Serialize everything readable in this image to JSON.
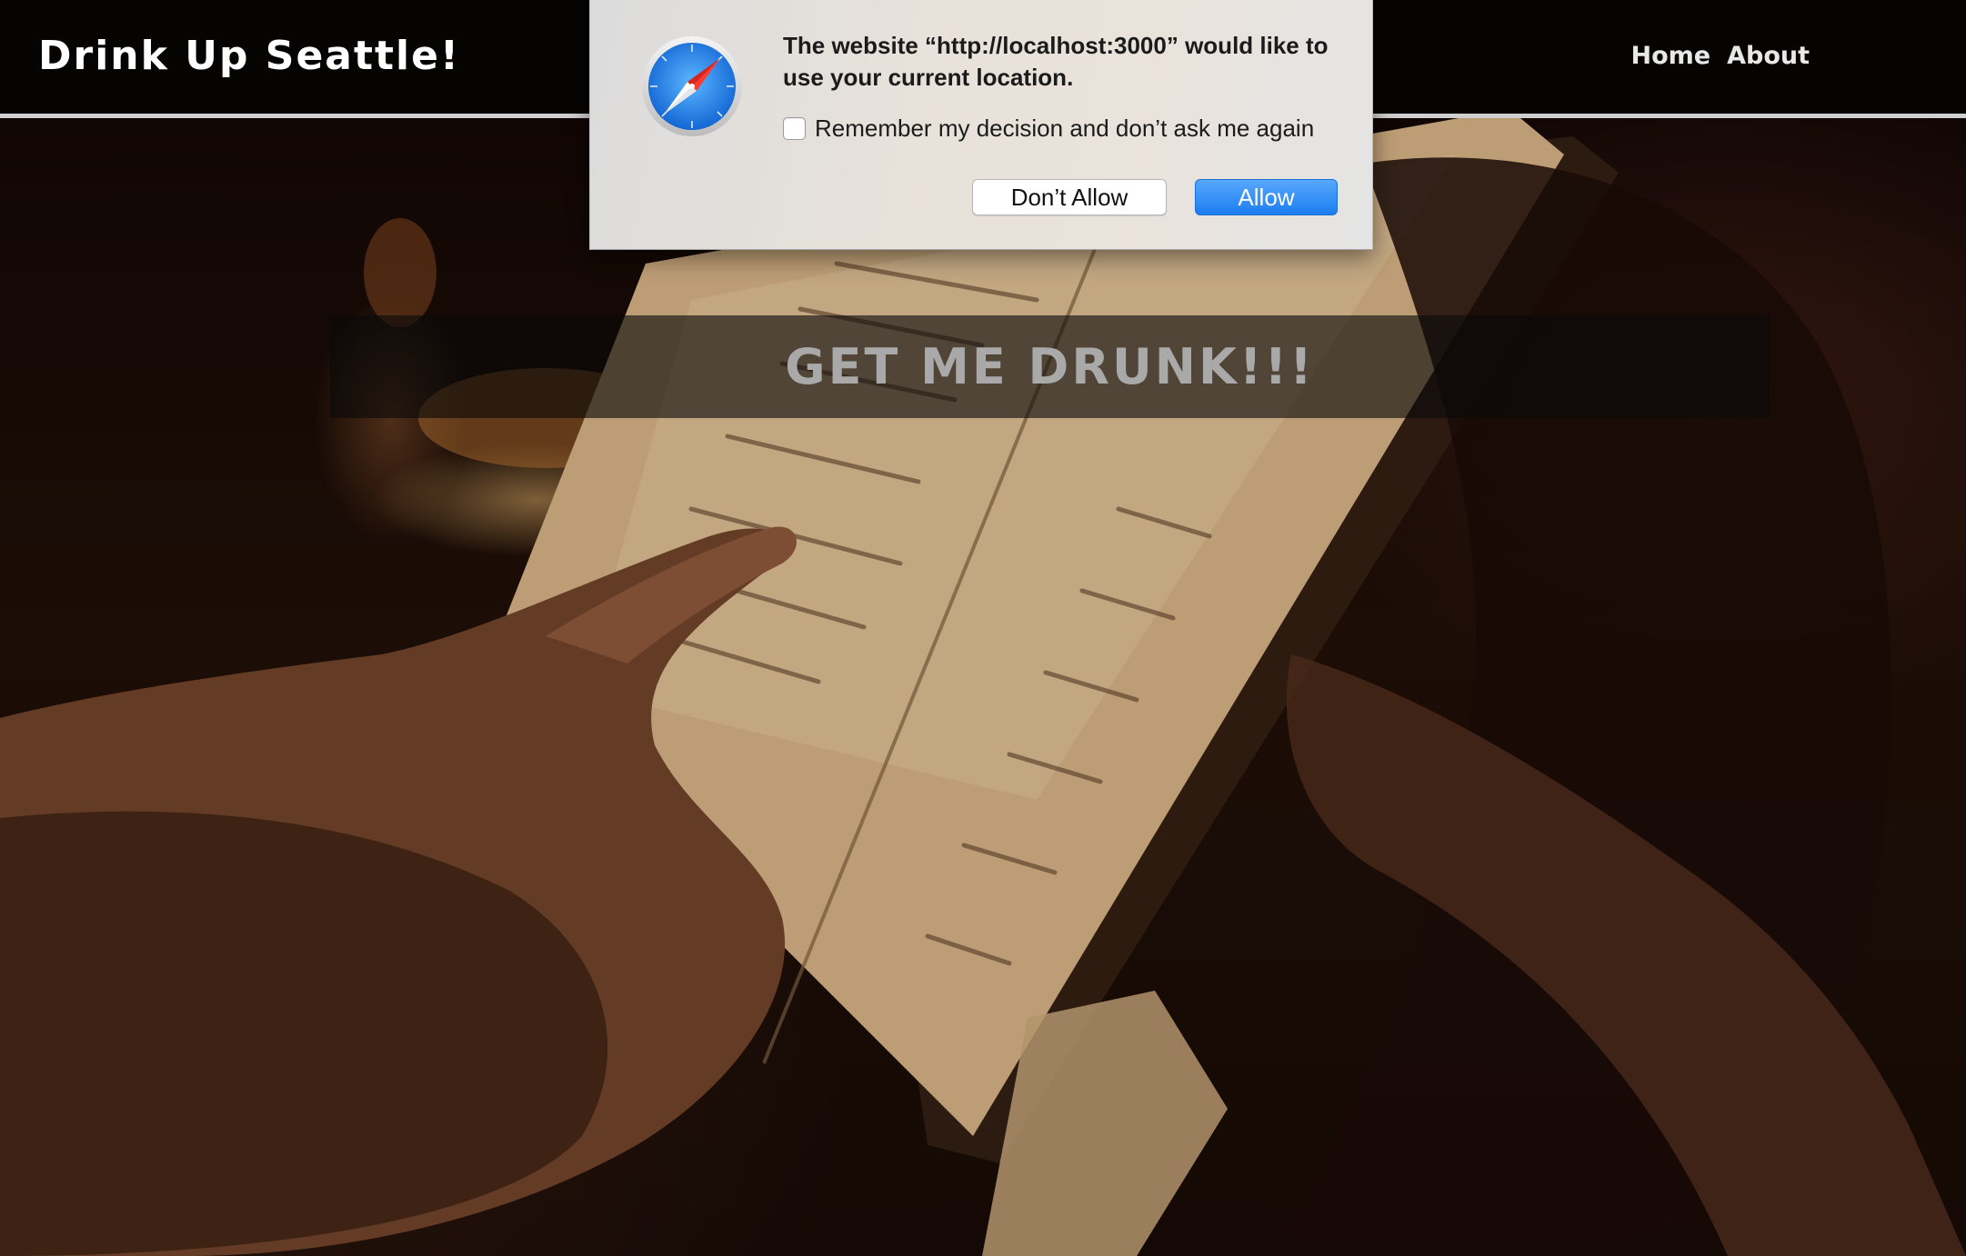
{
  "site": {
    "title": "Drink Up Seattle!",
    "nav": [
      {
        "label": "Home"
      },
      {
        "label": "About"
      }
    ]
  },
  "hero": {
    "cta_text": "GET ME DRUNK!!!"
  },
  "location_dialog": {
    "message": "The website “http://localhost:3000” would like to use your current location.",
    "remember_label": "Remember my decision and don’t ask me again",
    "remember_checked": false,
    "dont_allow_label": "Don’t Allow",
    "allow_label": "Allow",
    "icon": "safari-compass-icon"
  },
  "colors": {
    "header_bg": "#050403",
    "allow_button": "#1c7df1",
    "cta_text": "#a9a9a9"
  }
}
